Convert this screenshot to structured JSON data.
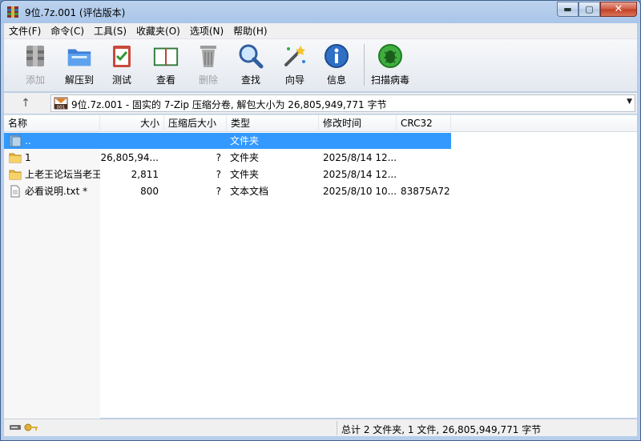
{
  "window": {
    "title": "9位.7z.001 (评估版本)",
    "controls": {
      "minimize": "▬",
      "maximize": "▢",
      "close": "✕"
    }
  },
  "menu": [
    "文件(F)",
    "命令(C)",
    "工具(S)",
    "收藏夹(O)",
    "选项(N)",
    "帮助(H)"
  ],
  "toolbar": [
    {
      "label": "添加",
      "icon": "add-archive-icon",
      "enabled": false
    },
    {
      "label": "解压到",
      "icon": "extract-icon",
      "enabled": true
    },
    {
      "label": "测试",
      "icon": "test-icon",
      "enabled": true
    },
    {
      "label": "查看",
      "icon": "view-book-icon",
      "enabled": true
    },
    {
      "label": "删除",
      "icon": "delete-trash-icon",
      "enabled": false
    },
    {
      "label": "查找",
      "icon": "find-magnifier-icon",
      "enabled": true
    },
    {
      "label": "向导",
      "icon": "wizard-wand-icon",
      "enabled": true
    },
    {
      "label": "信息",
      "icon": "info-icon",
      "enabled": true
    },
    {
      "label": "扫描病毒",
      "icon": "virus-scan-icon",
      "enabled": true
    }
  ],
  "address": {
    "up_label": "↑",
    "path": "9位.7z.001 - 固实的 7-Zip 压缩分卷, 解包大小为 26,805,949,771 字节",
    "dropdown": "▼"
  },
  "columns": {
    "name": "名称",
    "size": "大小",
    "packed": "压缩后大小",
    "type": "类型",
    "modified": "修改时间",
    "crc": "CRC32"
  },
  "files": [
    {
      "name": "..",
      "size": "",
      "packed": "",
      "type": "文件夹",
      "modified": "",
      "crc": "",
      "icon": "parent-folder-icon",
      "selected": true
    },
    {
      "name": "1",
      "size": "26,805,94...",
      "packed": "?",
      "type": "文件夹",
      "modified": "2025/8/14 12...",
      "crc": "",
      "icon": "folder-icon",
      "selected": false
    },
    {
      "name": "上老王论坛当老王",
      "size": "2,811",
      "packed": "?",
      "type": "文件夹",
      "modified": "2025/8/14 12...",
      "crc": "",
      "icon": "folder-icon",
      "selected": false
    },
    {
      "name": "必看说明.txt *",
      "size": "800",
      "packed": "?",
      "type": "文本文档",
      "modified": "2025/8/10 10...",
      "crc": "83875A72",
      "icon": "text-file-icon",
      "selected": false
    }
  ],
  "status": {
    "summary": "总计 2 文件夹, 1 文件, 26,805,949,771 字节"
  },
  "colors": {
    "selection": "#3399ff",
    "title_bar": "#bcd3ee"
  }
}
